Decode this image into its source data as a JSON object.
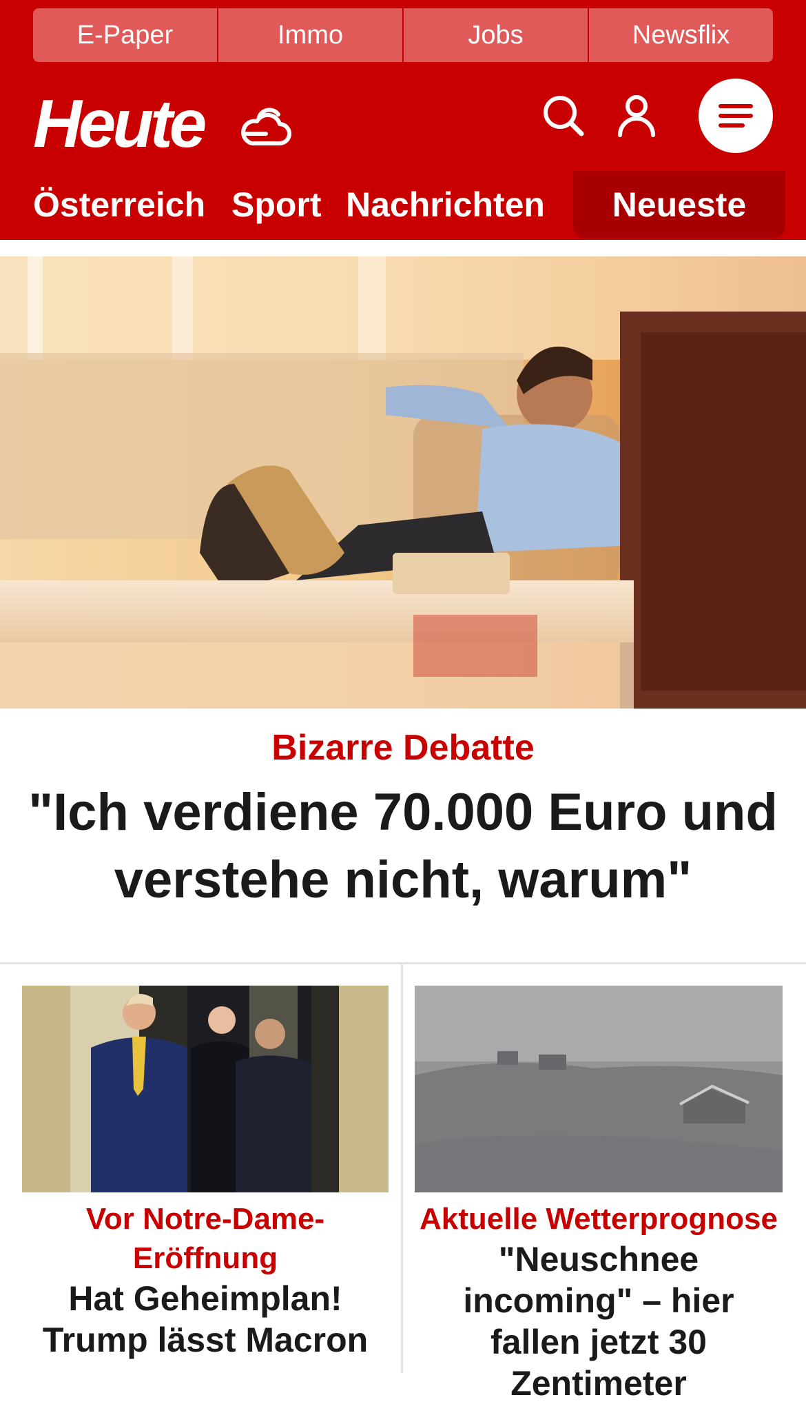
{
  "top_nav": [
    "E-Paper",
    "Immo",
    "Jobs",
    "Newsflix"
  ],
  "brand": {
    "logo_text": "Heute"
  },
  "section_nav": {
    "items": [
      "Österreich",
      "Sport",
      "Nachrichten"
    ],
    "latest": "Neueste"
  },
  "hero": {
    "kicker": "Bizarre Debatte",
    "headline": "\"Ich verdiene 70.000 Euro und verstehe nicht, warum\""
  },
  "cards": [
    {
      "kicker": "Vor Notre-Dame-Eröffnung",
      "headline": "Hat Geheimplan! Trump lässt Macron"
    },
    {
      "kicker": "Aktuelle Wetterprognose",
      "headline": "\"Neuschnee incoming\" – hier fallen jetzt 30 Zentimeter"
    }
  ],
  "colors": {
    "brand_red": "#c80000",
    "dark_red": "#a80000",
    "text": "#1a1a1a"
  },
  "icons": [
    "weather-cloud-icon",
    "search-icon",
    "user-icon",
    "menu-icon"
  ]
}
